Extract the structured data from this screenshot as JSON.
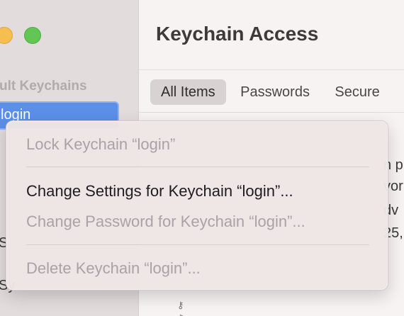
{
  "sidebar": {
    "heading": "ult Keychains",
    "selected_item": "login",
    "fragments": [
      "S",
      "Sy"
    ]
  },
  "window": {
    "title": "Keychain Access"
  },
  "tabs": [
    {
      "label": "All Items"
    },
    {
      "label": "Passwords"
    },
    {
      "label": "Secure"
    }
  ],
  "list": {
    "clipped_text": [
      "n p",
      "vor",
      "dv",
      "25,"
    ],
    "row_icons": [
      "key-icon",
      "key-icon"
    ]
  },
  "context_menu": {
    "items": [
      {
        "label": "Lock Keychain “login”"
      },
      {
        "label": "Change Settings for Keychain “login”..."
      },
      {
        "label": "Change Password for Keychain “login”..."
      },
      {
        "label": "Delete Keychain “login”..."
      }
    ]
  },
  "colors": {
    "selection": "#5b8fe8",
    "traffic_yellow": "#f6be4f",
    "traffic_green": "#62c655"
  }
}
